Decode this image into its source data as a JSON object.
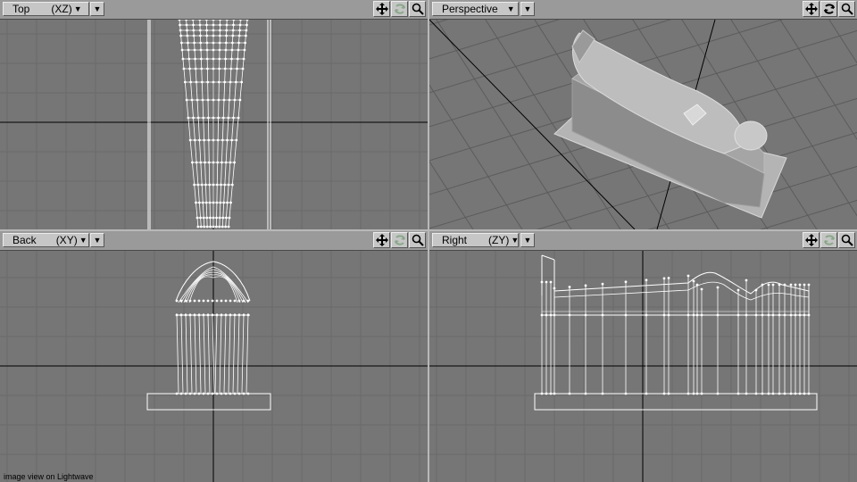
{
  "app": "Lightwave",
  "caption": "image view on Lightwave",
  "viewports": {
    "top": {
      "label": "Top",
      "axis": "(XZ)",
      "arrow": "▼",
      "drop": "▼"
    },
    "perspective": {
      "label": "Perspective",
      "axis": "",
      "arrow": "▼",
      "drop": "▼"
    },
    "back": {
      "label": "Back",
      "axis": "(XY)",
      "arrow": "▼",
      "drop": "▼"
    },
    "right": {
      "label": "Right",
      "axis": "(ZY)",
      "arrow": "▼",
      "drop": "▼"
    }
  },
  "tools": [
    "move-view-icon",
    "rotate-view-icon",
    "zoom-view-icon"
  ],
  "colors": {
    "viewport_bg": "#767676",
    "grid": "#6a6a6a",
    "axis": "#000000",
    "wire": "#ffffff",
    "header": "#9a9a9a",
    "button": "#c6c6c6"
  }
}
